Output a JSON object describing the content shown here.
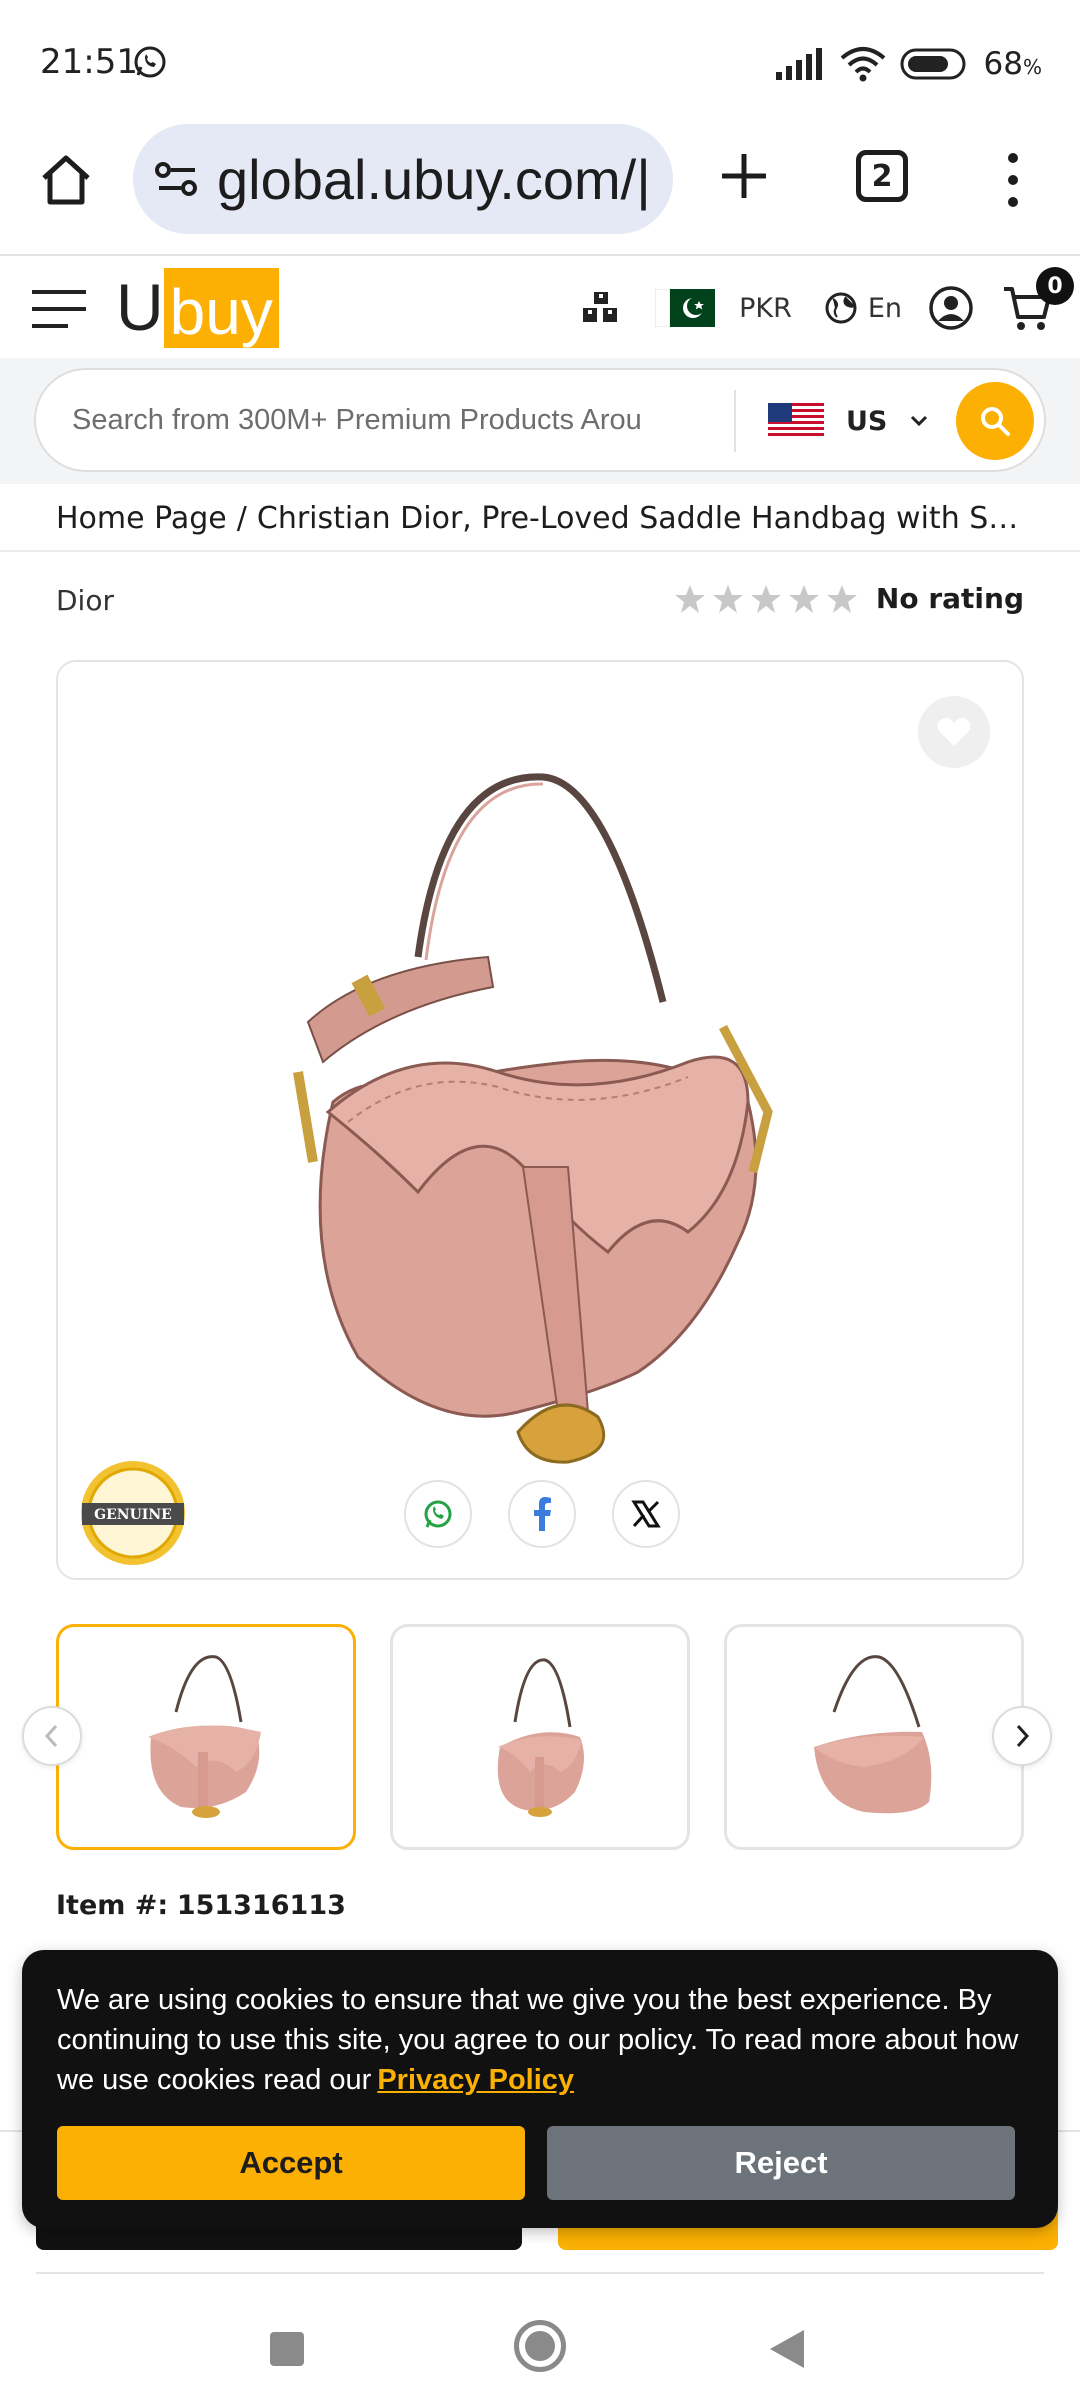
{
  "status_bar": {
    "time": "21:51",
    "battery": "68",
    "battery_unit": "%"
  },
  "browser": {
    "url": "global.ubuy.com/|",
    "tab_count": "2"
  },
  "header": {
    "logo_prefix": "U",
    "logo_box": "buy",
    "currency": "PKR",
    "language": "En",
    "cart_count": "0"
  },
  "search": {
    "placeholder": "Search from 300M+ Premium Products Arou",
    "country": "US"
  },
  "breadcrumb": {
    "home": "Home Page",
    "separator": "/",
    "current": "Christian Dior, Pre-Loved Saddle Handbag with Stra..."
  },
  "product": {
    "brand": "Dior",
    "rating_label": "No rating",
    "item_label": "Item #:",
    "item_number": "151316113",
    "badge_text": "GENUINE"
  },
  "cookie": {
    "message": "We are using cookies to ensure that we give you the best experience. By continuing to use this site, you agree to our policy. To read more about how we use cookies read our",
    "link_label": "Privacy Policy",
    "accept_label": "Accept",
    "reject_label": "Reject"
  },
  "colors": {
    "accent": "#fbb003",
    "product_pink": "#dfa59b",
    "reject_gray": "#6c737a"
  }
}
